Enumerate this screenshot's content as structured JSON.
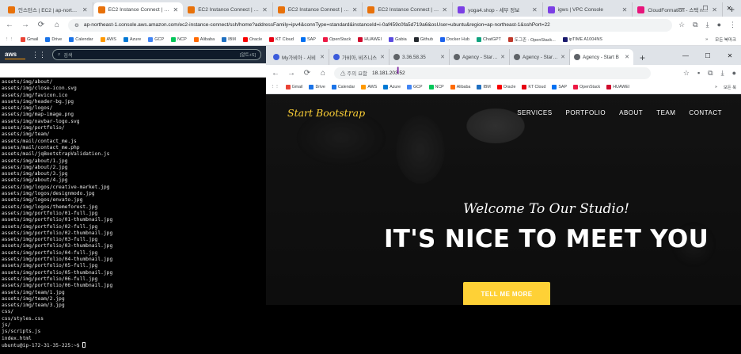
{
  "outer_browser": {
    "tabs": [
      {
        "label": "인스턴스 | EC2 | ap-northeast",
        "color": "#e8710a"
      },
      {
        "label": "EC2 Instance Connect | ap-no",
        "color": "#e8710a",
        "active": true
      },
      {
        "label": "EC2 Instance Connect | ap-no",
        "color": "#e8710a"
      },
      {
        "label": "EC2 Instance Connect | ap-no",
        "color": "#e8710a"
      },
      {
        "label": "EC2 Instance Connect | ap-no",
        "color": "#e8710a"
      },
      {
        "label": "yoga4.shop - 세부 정보",
        "color": "#7b3fe4"
      },
      {
        "label": "igws | VPC Console",
        "color": "#7b3fe4"
      },
      {
        "label": "CloudFormation - 스택 new-vp",
        "color": "#e7157b"
      }
    ],
    "new_tab": "+",
    "window_controls": {
      "min": "—",
      "max": "☐",
      "close": "✕"
    },
    "url": "ap-northeast-1.console.aws.amazon.com/ec2-instance-connect/ssh/home?addressFamily=ipv4&connType=standard&instanceId=i-0af459c0fa5d719a6&osUser=ubuntu&region=ap-northeast-1&sshPort=22",
    "bookmarks": [
      "Gmail",
      "Drive",
      "Calendar",
      "AWS",
      "Azure",
      "GCP",
      "NCP",
      "Alibaba",
      "IBM",
      "Oracle",
      "KT Cloud",
      "SAP",
      "OpenStack",
      "HUAWEI",
      "Gabia",
      "Github",
      "Docker Hub",
      "ChatGPT",
      "도그존 - OpenStack...",
      "ipTIME A1004NS"
    ],
    "bookmarks_more": "»",
    "bookmarks_folder": "모든 북마크"
  },
  "aws_console": {
    "logo": "aws",
    "search_placeholder": "검색",
    "search_shortcut": "[알트+S]"
  },
  "terminal": {
    "lines": [
      "assets/img/about/",
      "assets/img/close-icon.svg",
      "assets/img/favicon.ico",
      "assets/img/header-bg.jpg",
      "assets/img/logos/",
      "assets/img/map-image.png",
      "assets/img/navbar-logo.svg",
      "assets/img/portfolio/",
      "assets/img/team/",
      "assets/mail/contact_me.js",
      "assets/mail/contact_me.php",
      "assets/mail/jqBootstrapValidation.js",
      "assets/img/about/1.jpg",
      "assets/img/about/2.jpg",
      "assets/img/about/3.jpg",
      "assets/img/about/4.jpg",
      "assets/img/logos/creative-market.jpg",
      "assets/img/logos/designmodo.jpg",
      "assets/img/logos/envato.jpg",
      "assets/img/logos/themeforest.jpg",
      "assets/img/portfolio/01-full.jpg",
      "assets/img/portfolio/01-thumbnail.jpg",
      "assets/img/portfolio/02-full.jpg",
      "assets/img/portfolio/02-thumbnail.jpg",
      "assets/img/portfolio/03-full.jpg",
      "assets/img/portfolio/03-thumbnail.jpg",
      "assets/img/portfolio/04-full.jpg",
      "assets/img/portfolio/04-thumbnail.jpg",
      "assets/img/portfolio/05-full.jpg",
      "assets/img/portfolio/05-thumbnail.jpg",
      "assets/img/portfolio/06-full.jpg",
      "assets/img/portfolio/06-thumbnail.jpg",
      "assets/img/team/1.jpg",
      "assets/img/team/2.jpg",
      "assets/img/team/3.jpg",
      "css/",
      "css/styles.css",
      "js/",
      "js/scripts.js",
      "index.html"
    ],
    "prompt": "ubuntu@ip-172-31-35-225:~$ "
  },
  "inner_browser": {
    "tabs": [
      {
        "label": "My가비아 - 서비",
        "color": "#3b5bdb"
      },
      {
        "label": "가비아, 비즈니스",
        "color": "#3b5bdb"
      },
      {
        "label": "3.36.58.35",
        "color": "#5f6368"
      },
      {
        "label": "Agency - Start B",
        "color": "#5f6368"
      },
      {
        "label": "Agency - Start B",
        "color": "#5f6368"
      },
      {
        "label": "Agency - Start B",
        "color": "#5f6368",
        "active": true
      }
    ],
    "new_tab": "+",
    "window_controls": {
      "min": "—",
      "max": "☐",
      "close": "✕"
    },
    "url_warning": "⚠ 주의 요함",
    "url": "18.181.203.52",
    "bookmarks": [
      "Gmail",
      "Drive",
      "Calendar",
      "AWS",
      "Azure",
      "GCP",
      "NCP",
      "Alibaba",
      "IBM",
      "Oracle",
      "KT Cloud",
      "SAP",
      "OpenStack",
      "HUAWEI"
    ],
    "bookmarks_more": "»",
    "bookmarks_folder": "모든 북"
  },
  "website": {
    "brand": "Start Bootstrap",
    "nav": [
      "SERVICES",
      "PORTFOLIO",
      "ABOUT",
      "TEAM",
      "CONTACT"
    ],
    "subheading": "Welcome To Our Studio!",
    "heading": "IT'S NICE TO MEET YOU",
    "cta": "TELL ME MORE",
    "accent": "#fed136"
  }
}
